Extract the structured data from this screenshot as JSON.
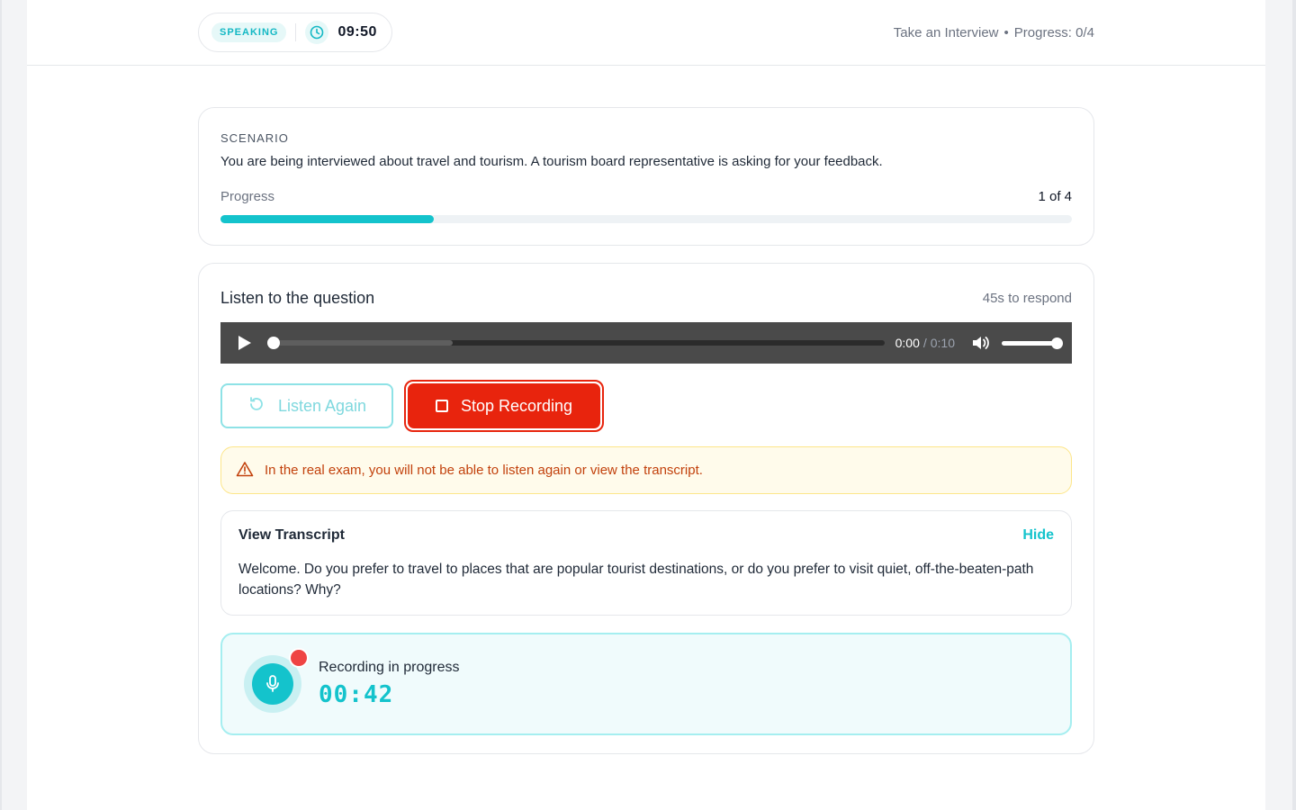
{
  "header": {
    "section_badge": "SPEAKING",
    "timer": "09:50",
    "task_name": "Take an Interview",
    "separator": "•",
    "progress_text": "Progress: 0/4"
  },
  "scenario": {
    "label": "SCENARIO",
    "text": "You are being interviewed about travel and tourism. A tourism board representative is asking for your feedback.",
    "progress_label": "Progress",
    "progress_count": "1 of 4",
    "progress_fraction": 0.25
  },
  "question": {
    "title": "Listen to the question",
    "response_time": "45s to respond",
    "audio": {
      "current_time": "0:00",
      "separator": "/",
      "duration": "0:10"
    },
    "listen_again_label": "Listen Again",
    "stop_recording_label": "Stop Recording",
    "warning": "In the real exam, you will not be able to listen again or view the transcript.",
    "transcript": {
      "title": "View Transcript",
      "toggle_label": "Hide",
      "text": "Welcome. Do you prefer to travel to places that are popular tourist destinations, or do you prefer to visit quiet, off-the-beaten-path locations? Why?"
    },
    "recording": {
      "label": "Recording in progress",
      "elapsed": "00:42"
    }
  },
  "colors": {
    "accent": "#14c3cc",
    "stop": "#e8240d",
    "warning_text": "#c2410c",
    "warning_bg": "#fffbeb"
  },
  "icons": {
    "timer": "clock-icon",
    "replay": "refresh-icon",
    "stop": "stop-square-icon",
    "warning": "warning-triangle-icon",
    "mic": "microphone-icon",
    "volume": "volume-icon",
    "play": "play-icon"
  }
}
